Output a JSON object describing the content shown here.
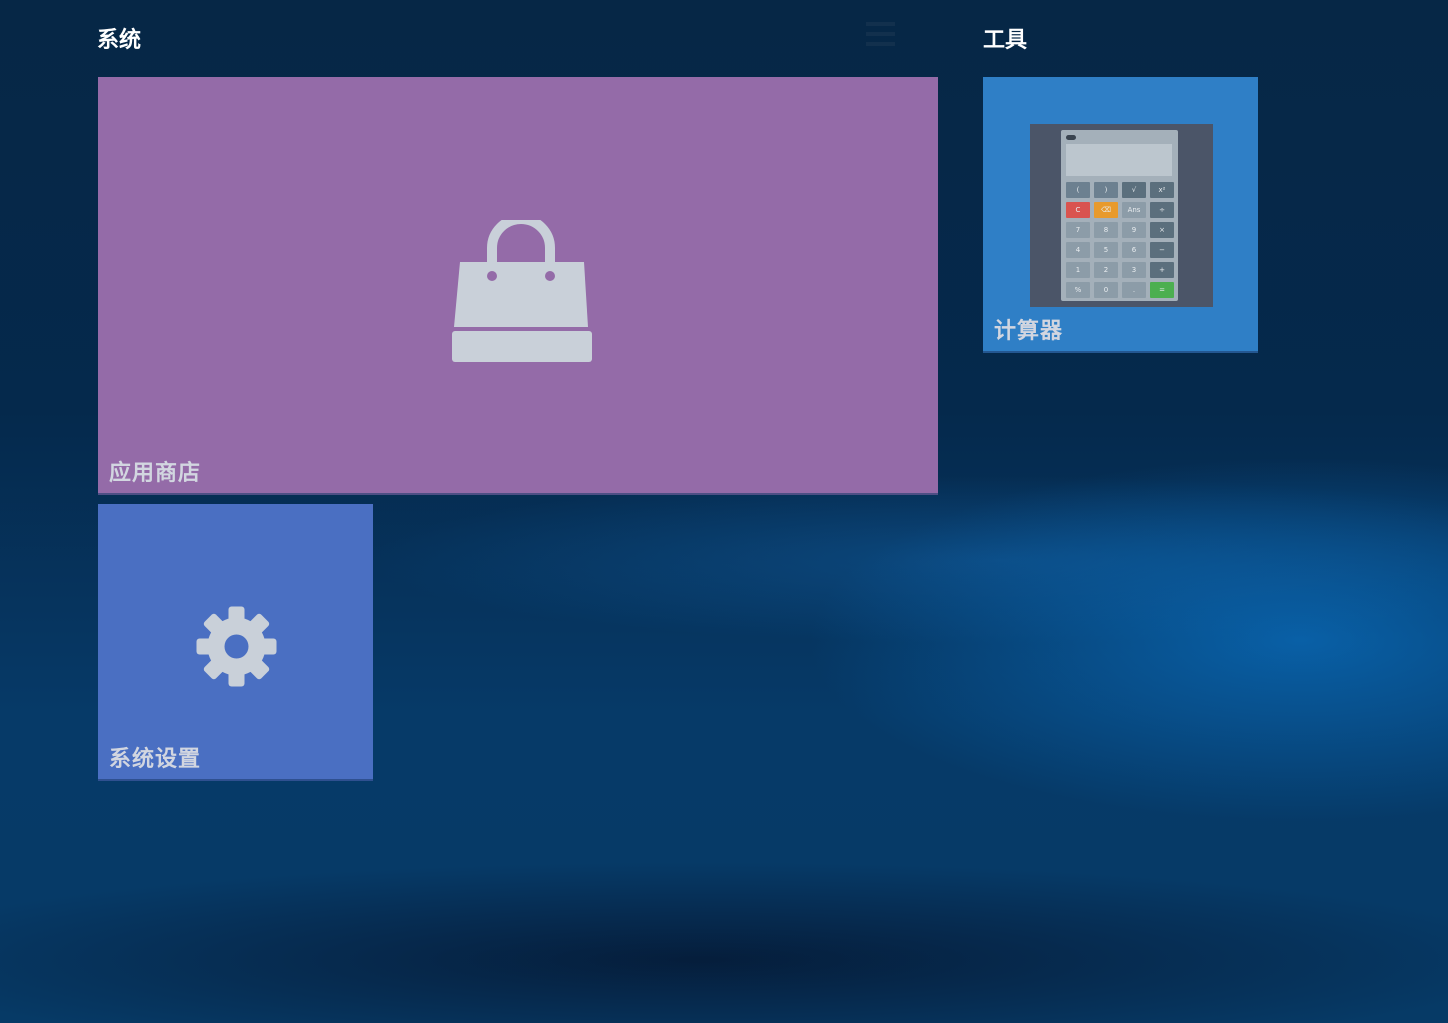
{
  "groups": [
    {
      "title": "系统"
    },
    {
      "title": "工具"
    }
  ],
  "menu": {
    "icon": "hamburger-menu-icon"
  },
  "tiles": {
    "store": {
      "label": "应用商店",
      "icon": "shopping-bag-icon",
      "color": "#946ba8"
    },
    "settings": {
      "label": "系统设置",
      "icon": "gear-icon",
      "color": "#4a6fc2"
    },
    "calculator": {
      "label": "计算器",
      "icon": "calculator-thumbnail",
      "color": "#2f7fc6"
    }
  },
  "calculator_keys": [
    {
      "label": "(",
      "color": "#6c8090"
    },
    {
      "label": ")",
      "color": "#6c8090"
    },
    {
      "label": "√",
      "color": "#5b6f7d"
    },
    {
      "label": "x²",
      "color": "#5b6f7d"
    },
    {
      "label": "C",
      "color": "#d9534f"
    },
    {
      "label": "⌫",
      "color": "#e89a2c"
    },
    {
      "label": "Ans",
      "color": "#8c9ca8"
    },
    {
      "label": "÷",
      "color": "#5b6f7d"
    },
    {
      "label": "7",
      "color": "#8c9ca8"
    },
    {
      "label": "8",
      "color": "#8c9ca8"
    },
    {
      "label": "9",
      "color": "#8c9ca8"
    },
    {
      "label": "×",
      "color": "#5b6f7d"
    },
    {
      "label": "4",
      "color": "#8c9ca8"
    },
    {
      "label": "5",
      "color": "#8c9ca8"
    },
    {
      "label": "6",
      "color": "#8c9ca8"
    },
    {
      "label": "−",
      "color": "#5b6f7d"
    },
    {
      "label": "1",
      "color": "#8c9ca8"
    },
    {
      "label": "2",
      "color": "#8c9ca8"
    },
    {
      "label": "3",
      "color": "#8c9ca8"
    },
    {
      "label": "+",
      "color": "#5b6f7d"
    },
    {
      "label": "%",
      "color": "#8c9ca8"
    },
    {
      "label": "0",
      "color": "#8c9ca8"
    },
    {
      "label": ".",
      "color": "#8c9ca8"
    },
    {
      "label": "=",
      "color": "#4caf50"
    }
  ]
}
